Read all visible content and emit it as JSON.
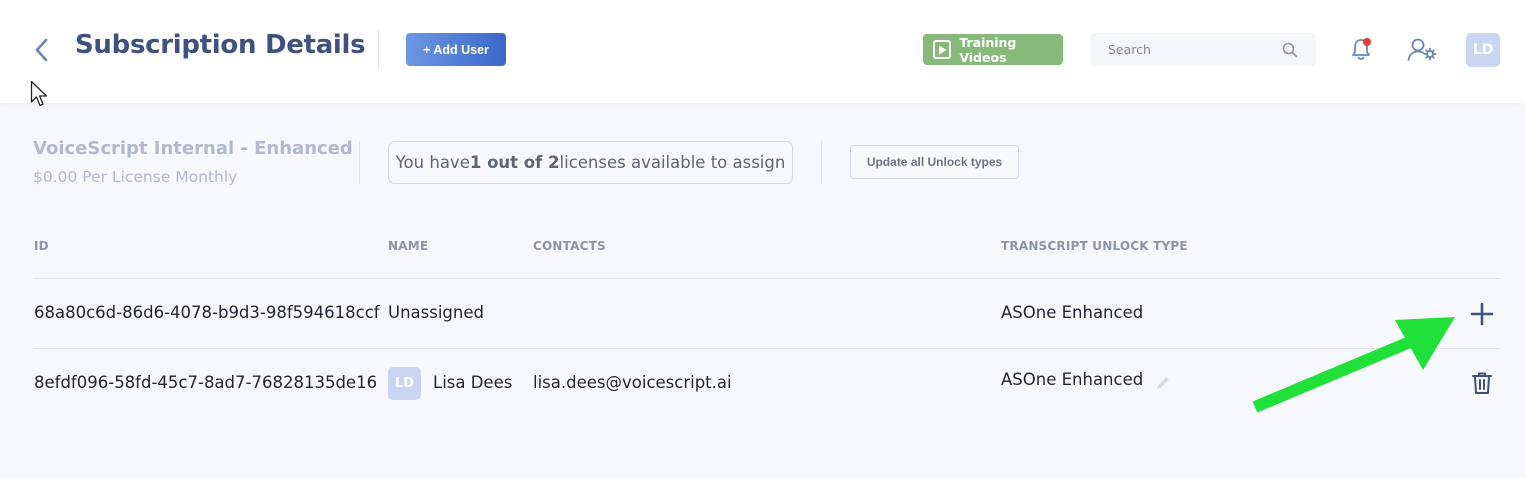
{
  "header": {
    "title": "Subscription Details",
    "add_user_label": "+ Add User",
    "training_label": "Training Videos",
    "search_placeholder": "Search",
    "avatar_initials": "LD"
  },
  "subscription": {
    "plan_name": "VoiceScript Internal - Enhanced",
    "plan_price": "$0.00 Per License Monthly",
    "license_prefix": "You have ",
    "license_count": "1 out of 2",
    "license_suffix": " licenses available to assign",
    "update_label": "Update all Unlock types"
  },
  "table": {
    "columns": [
      "ID",
      "NAME",
      "CONTACTS",
      "TRANSCRIPT UNLOCK TYPE"
    ],
    "rows": [
      {
        "id": "68a80c6d-86d6-4078-b9d3-98f594618ccf",
        "name": "Unassigned",
        "contact": "",
        "unlock_type": "ASOne Enhanced",
        "action": "plus-icon"
      },
      {
        "id": "8efdf096-58fd-45c7-8ad7-76828135de16",
        "avatar": "LD",
        "name": "Lisa Dees",
        "contact": "lisa.dees@voicescript.ai",
        "unlock_type": "ASOne Enhanced",
        "action": "trash-icon"
      }
    ]
  },
  "colors": {
    "title": "#3d5280",
    "accent_blue": "#3c67c9",
    "training_green": "#86b97a",
    "annotation_arrow": "#22e03a"
  }
}
